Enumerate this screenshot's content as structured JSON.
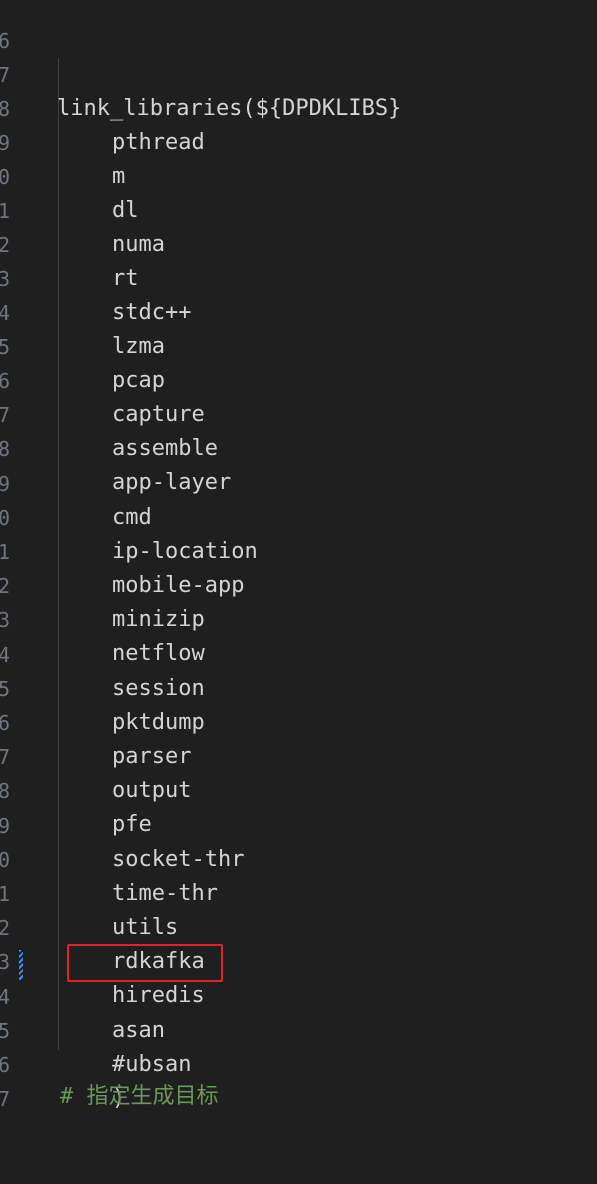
{
  "editor": {
    "lines": [
      {
        "number": "6",
        "text": ""
      },
      {
        "number": "7",
        "text": "link_libraries(${DPDKLIBS}"
      },
      {
        "number": "8",
        "text": "pthread"
      },
      {
        "number": "9",
        "text": "m"
      },
      {
        "number": "0",
        "text": "dl"
      },
      {
        "number": "1",
        "text": "numa"
      },
      {
        "number": "2",
        "text": "rt"
      },
      {
        "number": "3",
        "text": "stdc++"
      },
      {
        "number": "4",
        "text": "lzma"
      },
      {
        "number": "5",
        "text": "pcap"
      },
      {
        "number": "6",
        "text": "capture"
      },
      {
        "number": "7",
        "text": "assemble"
      },
      {
        "number": "8",
        "text": "app-layer"
      },
      {
        "number": "9",
        "text": "cmd"
      },
      {
        "number": "0",
        "text": "ip-location"
      },
      {
        "number": "1",
        "text": "mobile-app"
      },
      {
        "number": "2",
        "text": "minizip"
      },
      {
        "number": "3",
        "text": "netflow"
      },
      {
        "number": "4",
        "text": "session"
      },
      {
        "number": "5",
        "text": "pktdump"
      },
      {
        "number": "6",
        "text": "parser"
      },
      {
        "number": "7",
        "text": "output"
      },
      {
        "number": "8",
        "text": "pfe"
      },
      {
        "number": "9",
        "text": "socket-thr"
      },
      {
        "number": "0",
        "text": "time-thr"
      },
      {
        "number": "1",
        "text": "utils"
      },
      {
        "number": "2",
        "text": "rdkafka"
      },
      {
        "number": "3",
        "text": "hiredis"
      },
      {
        "number": "4",
        "text": "asan"
      },
      {
        "number": "5",
        "text": "#ubsan"
      },
      {
        "number": "6",
        "text": ")"
      },
      {
        "number": "7",
        "text": ""
      }
    ],
    "partial_comment": "# 指定生成目标",
    "highlight_color": "#e02424",
    "modified_marker_color": "#3794ff",
    "background_color": "#1f1f1f",
    "text_color": "#d4d4d4"
  }
}
